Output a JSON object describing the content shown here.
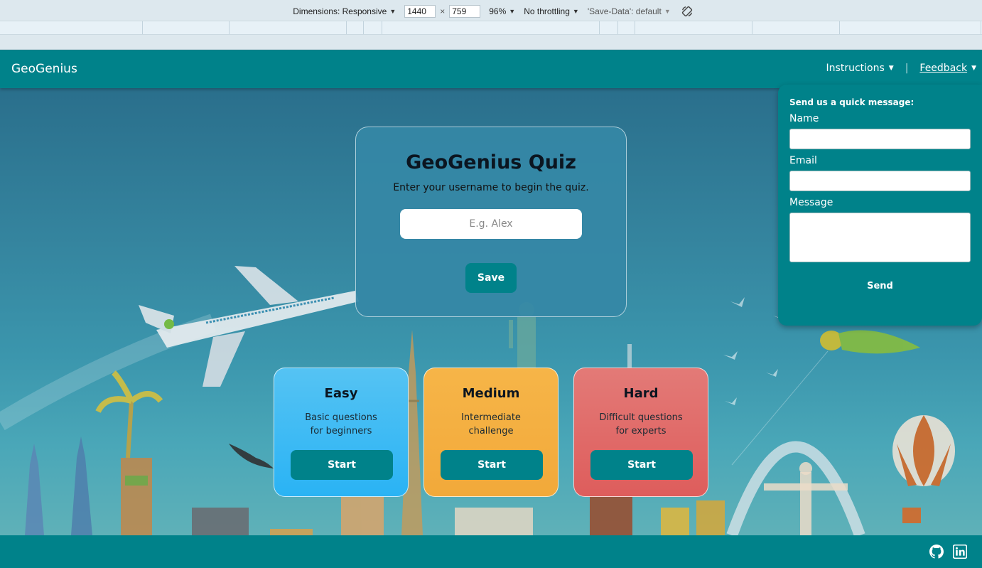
{
  "devtools": {
    "dimensions_label": "Dimensions: Responsive",
    "width_value": "1440",
    "times": "×",
    "height_value": "759",
    "zoom": "96%",
    "throttling": "No throttling",
    "save_data": "'Save-Data': default"
  },
  "navbar": {
    "brand": "GeoGenius",
    "instructions": "Instructions",
    "separator": "|",
    "feedback": "Feedback"
  },
  "quiz": {
    "title": "GeoGenius Quiz",
    "subtitle": "Enter your username to begin the quiz.",
    "username_placeholder": "E.g. Alex",
    "save_label": "Save"
  },
  "levels": [
    {
      "title": "Easy",
      "desc_line1": "Basic questions",
      "desc_line2": "for beginners",
      "button": "Start"
    },
    {
      "title": "Medium",
      "desc_line1": "Intermediate",
      "desc_line2": "challenge",
      "button": "Start"
    },
    {
      "title": "Hard",
      "desc_line1": "Difficult questions",
      "desc_line2": "for experts",
      "button": "Start"
    }
  ],
  "feedback_form": {
    "heading": "Send us a quick message:",
    "name_label": "Name",
    "email_label": "Email",
    "message_label": "Message",
    "send_label": "Send"
  },
  "footer": {
    "icons": [
      "github-icon",
      "linkedin-icon"
    ]
  },
  "colors": {
    "teal": "#00828a",
    "easy": "#2ab3f4",
    "medium": "#f2a93a",
    "hard": "#de5d5c"
  }
}
